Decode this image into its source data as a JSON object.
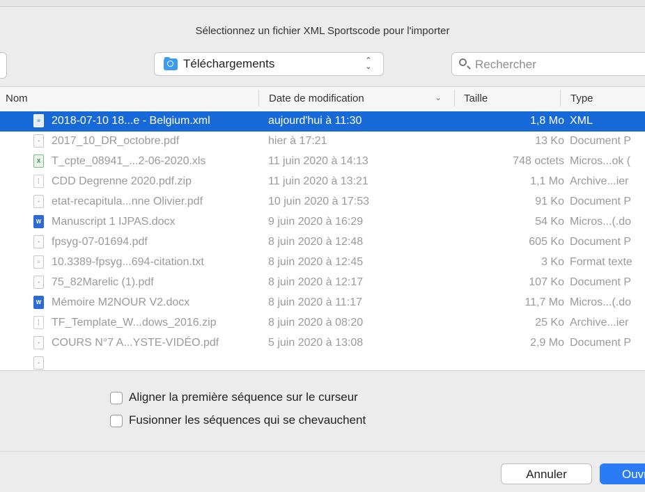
{
  "dialog": {
    "title": "Sélectionnez un fichier XML Sportscode pour l'importer"
  },
  "location": {
    "label": "Téléchargements",
    "icon": "downloads-folder-icon"
  },
  "search": {
    "placeholder": "Rechercher",
    "icon": "search-icon"
  },
  "columns": {
    "name": "Nom",
    "date": "Date de modification",
    "size": "Taille",
    "type": "Type"
  },
  "files": [
    {
      "name": "2018-07-10 18...e - Belgium.xml",
      "date": "aujourd'hui à 11:30",
      "size": "1,8 Mo",
      "type": "XML",
      "icon": "xml-file-icon",
      "selected": true
    },
    {
      "name": "2017_10_DR_octobre.pdf",
      "date": "hier à 17:21",
      "size": "13 Ko",
      "type": "Document P",
      "icon": "pdf-file-icon"
    },
    {
      "name": "T_cpte_08941_...2-06-2020.xls",
      "date": "11 juin 2020 à 14:13",
      "size": "748 octets",
      "type": "Micros...ok (",
      "icon": "excel-file-icon"
    },
    {
      "name": "CDD Degrenne 2020.pdf.zip",
      "date": "11 juin 2020 à 13:21",
      "size": "1,1 Mo",
      "type": "Archive...ier",
      "icon": "archive-file-icon"
    },
    {
      "name": "etat-recapitula...nne Olivier.pdf",
      "date": "10 juin 2020 à 17:53",
      "size": "91 Ko",
      "type": "Document P",
      "icon": "pdf-file-icon"
    },
    {
      "name": "Manuscript 1 IJPAS.docx",
      "date": "9 juin 2020 à 16:29",
      "size": "54 Ko",
      "type": "Micros...(.do",
      "icon": "word-file-icon"
    },
    {
      "name": "fpsyg-07-01694.pdf",
      "date": "8 juin 2020 à 12:48",
      "size": "605 Ko",
      "type": "Document P",
      "icon": "pdf-file-icon"
    },
    {
      "name": "10.3389-fpsyg...694-citation.txt",
      "date": "8 juin 2020 à 12:45",
      "size": "3 Ko",
      "type": "Format texte",
      "icon": "text-file-icon"
    },
    {
      "name": "75_82Marelic (1).pdf",
      "date": "8 juin 2020 à 12:17",
      "size": "107 Ko",
      "type": "Document P",
      "icon": "pdf-file-icon"
    },
    {
      "name": "Mémoire M2NOUR V2.docx",
      "date": "8 juin 2020 à 11:17",
      "size": "11,7 Mo",
      "type": "Micros...(.do",
      "icon": "word-file-icon"
    },
    {
      "name": "TF_Template_W...dows_2016.zip",
      "date": "8 juin 2020 à 08:20",
      "size": "25 Ko",
      "type": "Archive...ier",
      "icon": "archive-file-icon"
    },
    {
      "name": "COURS N°7 A...YSTE-VIDÉO.pdf",
      "date": "5 juin 2020 à 13:08",
      "size": "2,9 Mo",
      "type": "Document P",
      "icon": "pdf-file-icon"
    }
  ],
  "options": {
    "align_label": "Aligner la première séquence sur le curseur",
    "merge_label": "Fusionner les séquences qui se chevauchent"
  },
  "buttons": {
    "cancel": "Annuler",
    "open": "Ouvrir"
  },
  "colors": {
    "selection": "#1869d8",
    "primary_button": "#2a7bf5"
  }
}
